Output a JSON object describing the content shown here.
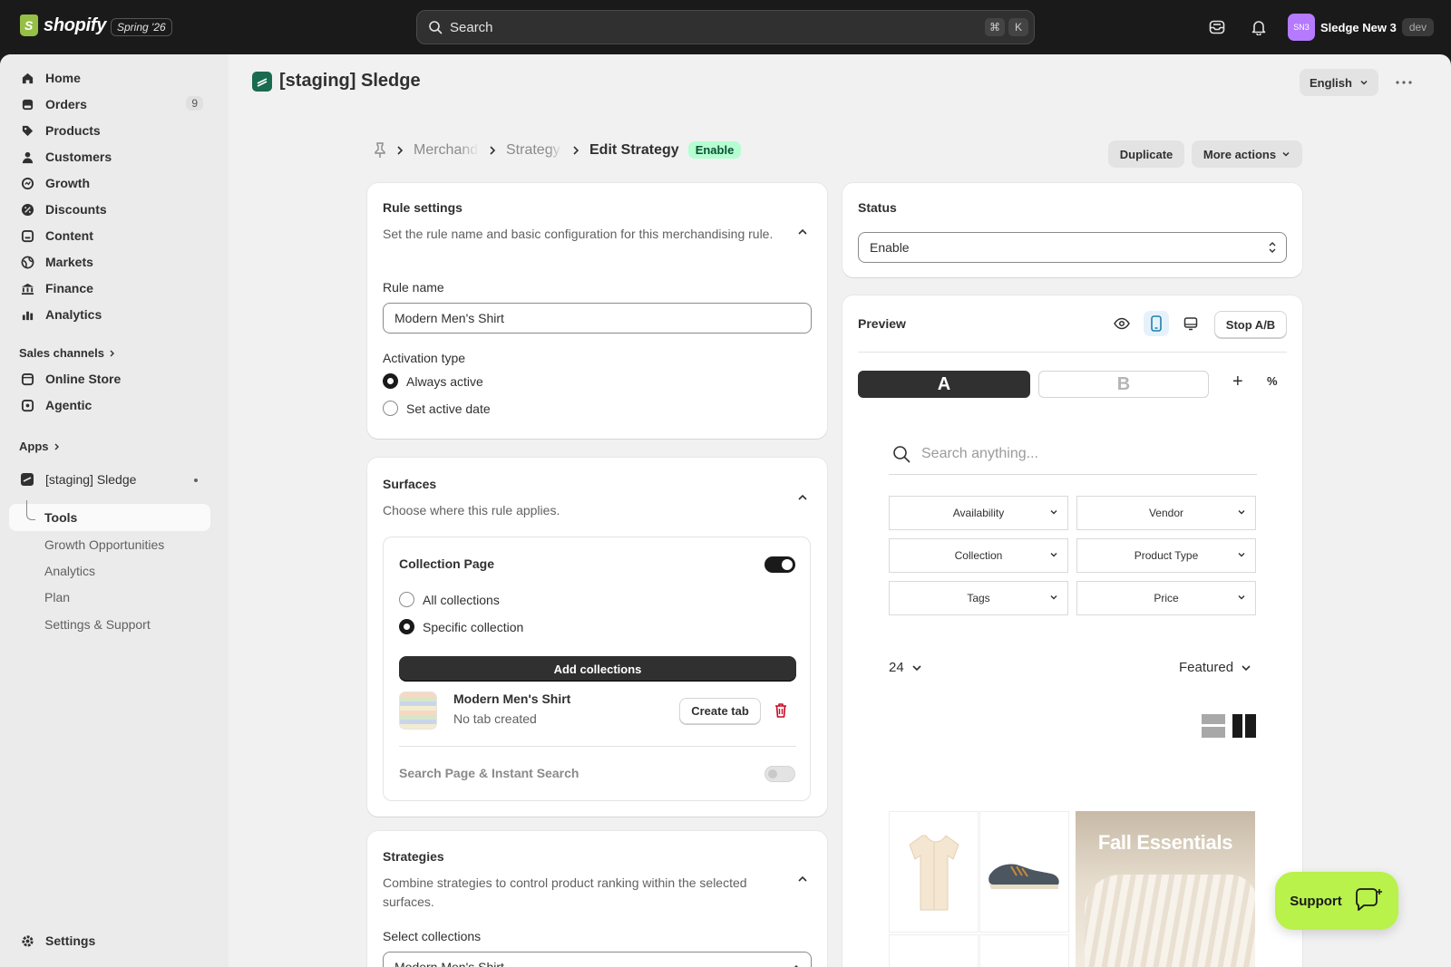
{
  "topbar": {
    "logo_text": "shopify",
    "edition": "Spring '26",
    "search_placeholder": "Search",
    "kbd_cmd": "⌘",
    "kbd_k": "K",
    "store_initials": "SN3",
    "store_name": "Sledge New 3",
    "env_badge": "dev"
  },
  "sidebar": {
    "items": [
      {
        "label": "Home",
        "icon": "home-icon"
      },
      {
        "label": "Orders",
        "icon": "orders-icon",
        "badge": "9"
      },
      {
        "label": "Products",
        "icon": "tag-icon"
      },
      {
        "label": "Customers",
        "icon": "person-icon"
      },
      {
        "label": "Growth",
        "icon": "growth-icon"
      },
      {
        "label": "Discounts",
        "icon": "discount-icon"
      },
      {
        "label": "Content",
        "icon": "content-icon"
      },
      {
        "label": "Markets",
        "icon": "globe-icon"
      },
      {
        "label": "Finance",
        "icon": "bank-icon"
      },
      {
        "label": "Analytics",
        "icon": "chart-icon"
      }
    ],
    "sales_channels_label": "Sales channels",
    "channels": [
      {
        "label": "Online Store",
        "icon": "store-icon"
      },
      {
        "label": "Agentic",
        "icon": "agentic-icon"
      }
    ],
    "apps_label": "Apps",
    "app_name": "[staging] Sledge",
    "app_sub": [
      "Tools",
      "Growth Opportunities",
      "Analytics",
      "Plan",
      "Settings & Support"
    ],
    "settings_label": "Settings"
  },
  "header": {
    "app_title": "[staging] Sledge",
    "language": "English"
  },
  "breadcrumb": {
    "items": [
      "Merchandising",
      "Strategy"
    ],
    "current": "Edit Strategy",
    "status": "Enable",
    "duplicate": "Duplicate",
    "more_actions": "More actions"
  },
  "rule_settings": {
    "title": "Rule settings",
    "description": "Set the rule name and basic configuration for this merchandising rule.",
    "rule_name_label": "Rule name",
    "rule_name_value": "Modern Men's Shirt",
    "activation_label": "Activation type",
    "options": [
      "Always active",
      "Set active date"
    ]
  },
  "surfaces": {
    "title": "Surfaces",
    "description": "Choose where this rule applies.",
    "collection_page": "Collection Page",
    "collection_options": [
      "All collections",
      "Specific collection"
    ],
    "add_collections": "Add collections",
    "collection_item_name": "Modern Men's Shirt",
    "collection_item_sub": "No tab created",
    "create_tab": "Create tab",
    "search_page": "Search Page & Instant Search"
  },
  "strategies": {
    "title": "Strategies",
    "description": "Combine strategies to control product ranking within the selected surfaces.",
    "select_label": "Select collections",
    "select_value": "Modern Men's Shirt"
  },
  "status_card": {
    "title": "Status",
    "value": "Enable"
  },
  "preview": {
    "title": "Preview",
    "stop_ab": "Stop A/B",
    "variant_a": "A",
    "variant_b": "B",
    "plus": "+",
    "percent": "%",
    "search_placeholder": "Search anything...",
    "filters": [
      "Availability",
      "Vendor",
      "Collection",
      "Product Type",
      "Tags",
      "Price"
    ],
    "page_size": "24",
    "sort": "Featured",
    "banner_text": "Fall Essentials"
  },
  "support_label": "Support",
  "colors": {
    "accent_green": "#b8f24a",
    "badge_green": "#b4fed2",
    "delete_red": "#c70a24",
    "toggle_dark": "#1a1a1a"
  }
}
